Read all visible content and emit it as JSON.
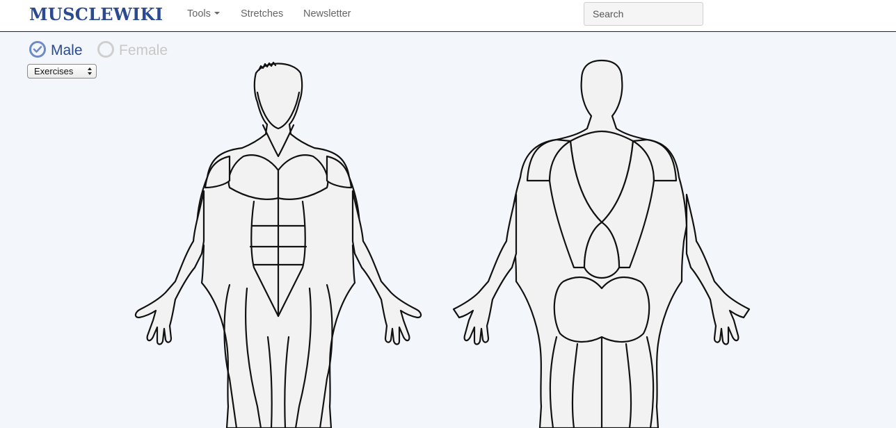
{
  "brand": "MUSCLEWIKI",
  "nav": {
    "tools": "Tools",
    "stretches": "Stretches",
    "newsletter": "Newsletter"
  },
  "search": {
    "placeholder": "Search",
    "value": ""
  },
  "gender": {
    "male": "Male",
    "female": "Female",
    "selected": "Male"
  },
  "mode_select": {
    "selected": "Exercises"
  },
  "colors": {
    "brand": "#2b4a90",
    "background": "#f3f6fa",
    "radio_checked": "#6d8bc6",
    "radio_unchecked": "#cfcfcf"
  }
}
